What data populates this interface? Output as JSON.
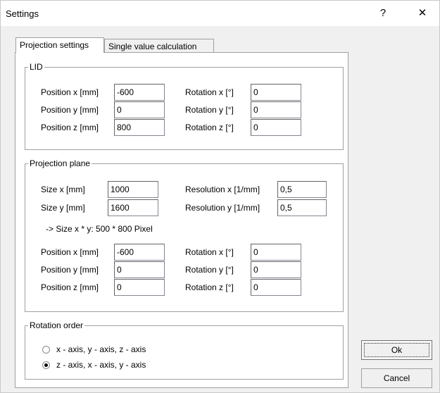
{
  "window": {
    "title": "Settings",
    "help_label": "?",
    "close_label": "✕"
  },
  "tabs": [
    {
      "label": "Projection settings"
    },
    {
      "label": "Single value calculation"
    }
  ],
  "lid": {
    "title": "LID",
    "position_x_label": "Position x [mm]",
    "position_x_value": "-600",
    "position_y_label": "Position y [mm]",
    "position_y_value": "0",
    "position_z_label": "Position z [mm]",
    "position_z_value": "800",
    "rotation_x_label": "Rotation x [°]",
    "rotation_x_value": "0",
    "rotation_y_label": "Rotation y [°]",
    "rotation_y_value": "0",
    "rotation_z_label": "Rotation z [°]",
    "rotation_z_value": "0"
  },
  "plane": {
    "title": "Projection plane",
    "size_x_label": "Size x [mm]",
    "size_x_value": "1000",
    "size_y_label": "Size y [mm]",
    "size_y_value": "1600",
    "res_x_label": "Resolution x [1/mm]",
    "res_x_value": "0,5",
    "res_y_label": "Resolution y [1/mm]",
    "res_y_value": "0,5",
    "pixel_info": "-> Size x * y: 500 * 800 Pixel",
    "position_x_label": "Position x [mm]",
    "position_x_value": "-600",
    "position_y_label": "Position y [mm]",
    "position_y_value": "0",
    "position_z_label": "Position z [mm]",
    "position_z_value": "0",
    "rotation_x_label": "Rotation x [°]",
    "rotation_x_value": "0",
    "rotation_y_label": "Rotation y [°]",
    "rotation_y_value": "0",
    "rotation_z_label": "Rotation z [°]",
    "rotation_z_value": "0"
  },
  "rotation_order": {
    "title": "Rotation order",
    "options": [
      {
        "label": "x - axis, y - axis, z - axis",
        "selected": false
      },
      {
        "label": "z - axis, x - axis, y - axis",
        "selected": true
      }
    ]
  },
  "buttons": {
    "ok": "Ok",
    "cancel": "Cancel"
  }
}
